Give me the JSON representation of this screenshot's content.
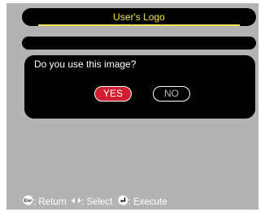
{
  "title": "User's Logo",
  "dialog": {
    "question": "Do you use this image?",
    "yes_label": "YES",
    "no_label": "NO"
  },
  "footer": {
    "return_icon": "esc-button-icon",
    "return_label": ": Return",
    "select_icon": "left-right-arrows-icon",
    "select_label": ": Select",
    "execute_icon": "enter-button-icon",
    "execute_label": ": Execute"
  },
  "colors": {
    "title_text": "#f4e54d",
    "yes_button": "#d11f2f",
    "panel_background": "#b3b3b3",
    "bar_background": "#000000"
  }
}
